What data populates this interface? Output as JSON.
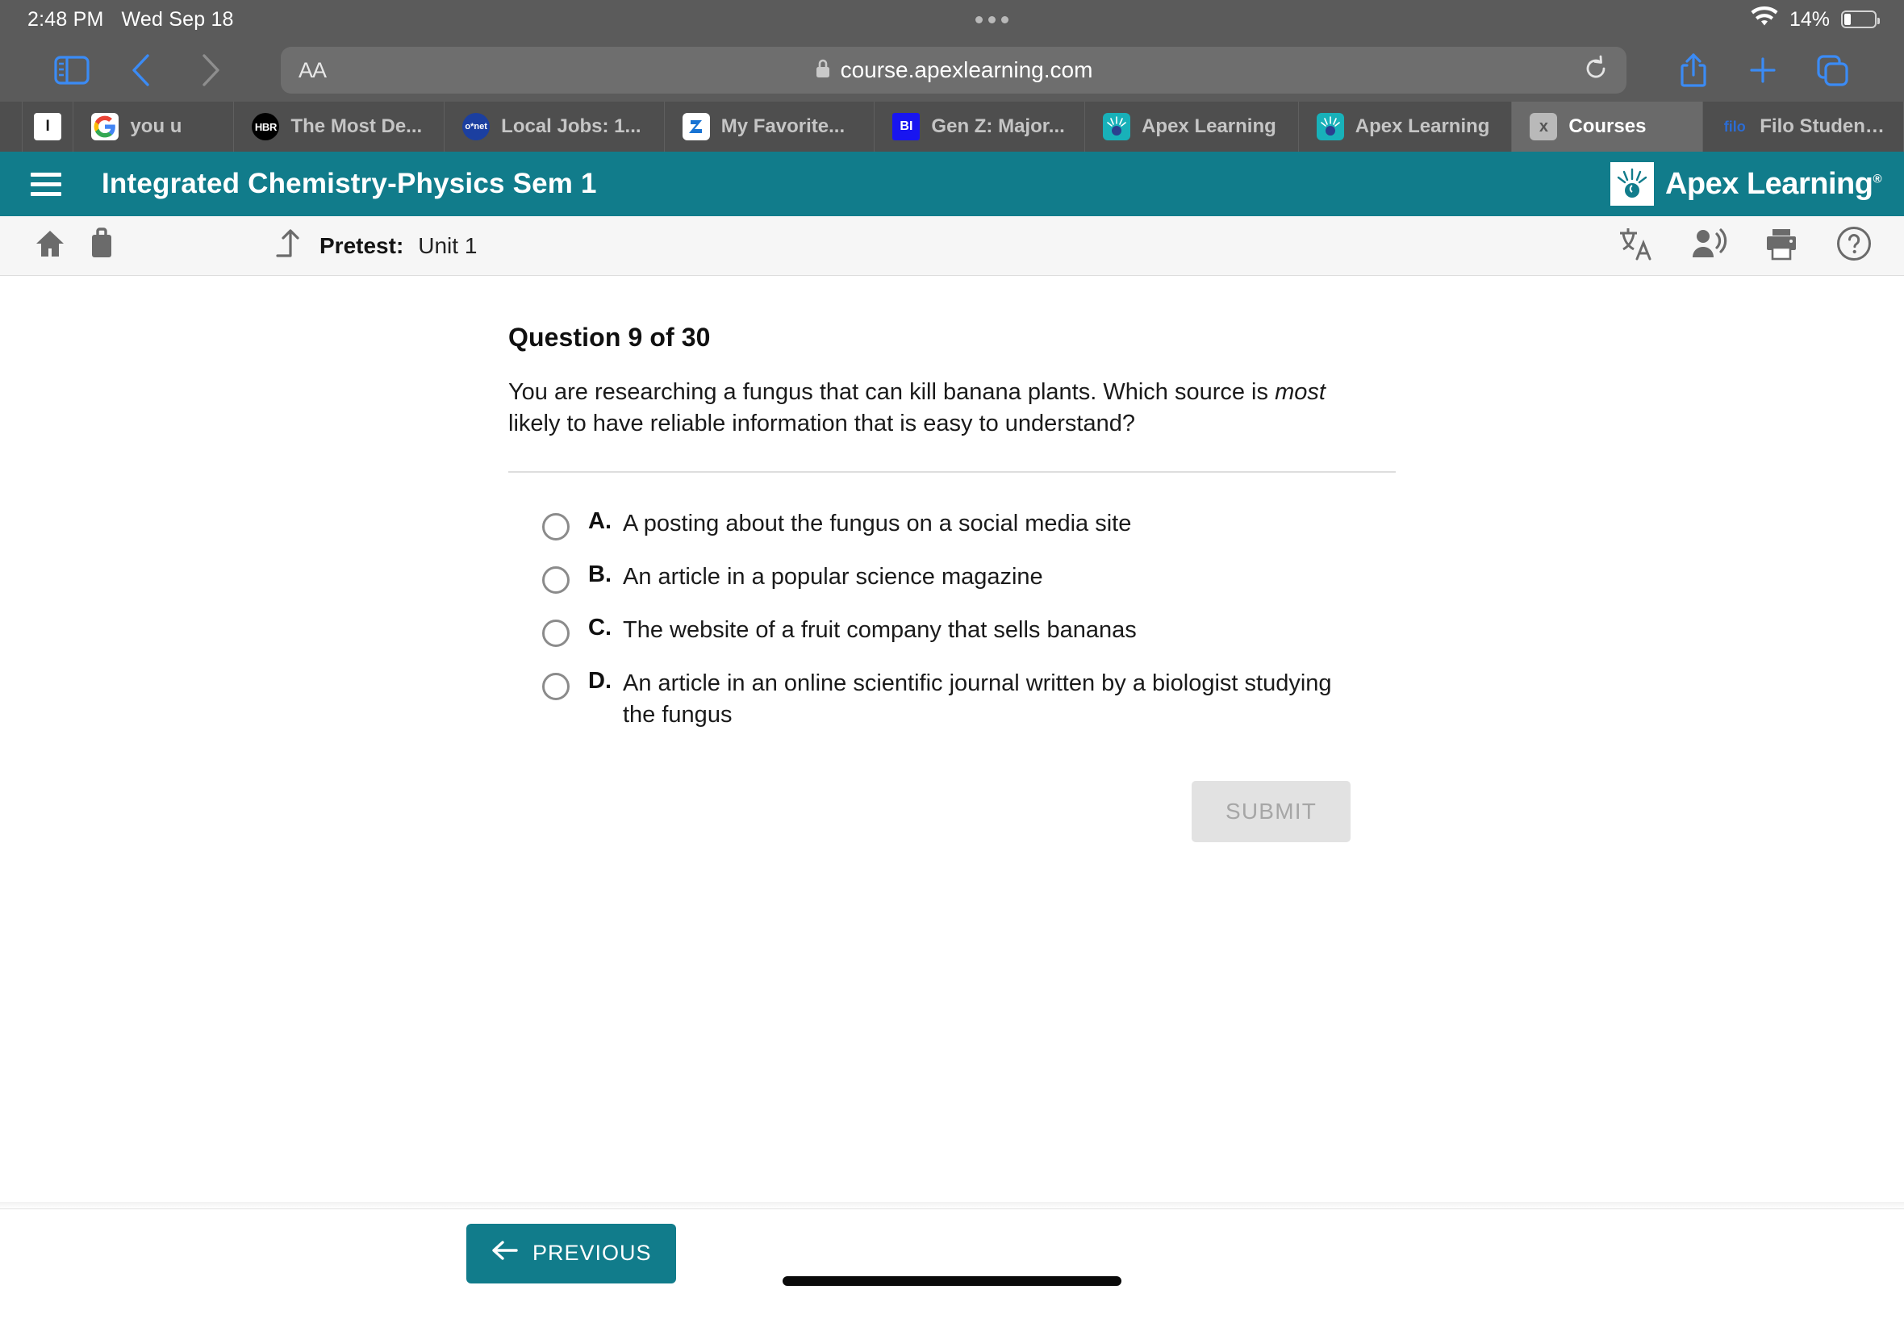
{
  "status_bar": {
    "time": "2:48 PM",
    "date": "Wed Sep 18",
    "battery_percent": "14%",
    "wifi_icon": "wifi-icon",
    "battery_icon": "battery-icon"
  },
  "browser": {
    "sidebar_icon": "sidebar-icon",
    "back_icon": "chevron-left-icon",
    "forward_icon": "chevron-right-icon",
    "text_size_label": "AA",
    "lock_icon": "lock-icon",
    "url": "course.apexlearning.com",
    "reload_icon": "reload-icon",
    "share_icon": "share-icon",
    "new_tab_icon": "plus-icon",
    "tabs_overview_icon": "tabs-icon",
    "tabs": [
      {
        "label": "",
        "favicon": "i-icon",
        "active": false,
        "narrow": true
      },
      {
        "label": "you u",
        "favicon": "google-icon",
        "active": false
      },
      {
        "label": "The Most De...",
        "favicon": "hbr-icon",
        "active": false
      },
      {
        "label": "Local Jobs: 1...",
        "favicon": "onet-icon",
        "active": false
      },
      {
        "label": "My Favorite...",
        "favicon": "zety-icon",
        "active": false
      },
      {
        "label": "Gen Z: Major...",
        "favicon": "business-insider-icon",
        "active": false
      },
      {
        "label": "Apex Learning",
        "favicon": "apex-icon",
        "active": false
      },
      {
        "label": "Apex Learning",
        "favicon": "apex-icon",
        "active": false
      },
      {
        "label": "Courses",
        "favicon": "x-icon",
        "active": true
      },
      {
        "label": "Filo Student:...",
        "favicon": "filo-icon",
        "active": false
      }
    ]
  },
  "app_header": {
    "menu_icon": "hamburger-menu-icon",
    "course_title": "Integrated Chemistry-Physics Sem 1",
    "brand_name": "Apex Learning",
    "brand_trademark": "®",
    "background_color": "#117c8b"
  },
  "sub_toolbar": {
    "home_icon": "home-icon",
    "briefcase_icon": "briefcase-icon",
    "upload_icon": "upload-arrow-icon",
    "breadcrumb_label": "Pretest:",
    "breadcrumb_value": "Unit 1",
    "translate_icon": "translate-icon",
    "read_aloud_icon": "read-aloud-icon",
    "print_icon": "print-icon",
    "help_icon": "help-circle-icon"
  },
  "question": {
    "title": "Question 9 of 30",
    "stem_part1": "You are researching a fungus that can kill banana plants. Which source is ",
    "stem_emphasis": "most",
    "stem_part2": " likely to have reliable information that is easy to understand?",
    "choices": [
      {
        "letter": "A.",
        "text": "A posting about the fungus on a social media site",
        "selected": false
      },
      {
        "letter": "B.",
        "text": "An article in a popular science magazine",
        "selected": false
      },
      {
        "letter": "C.",
        "text": "The website of a fruit company that sells bananas",
        "selected": false
      },
      {
        "letter": "D.",
        "text": "An article in an online scientific journal written by a biologist studying the fungus",
        "selected": false
      }
    ],
    "submit_label": "SUBMIT",
    "submit_enabled": false
  },
  "footer": {
    "previous_label": "PREVIOUS",
    "previous_icon": "arrow-left-icon"
  }
}
